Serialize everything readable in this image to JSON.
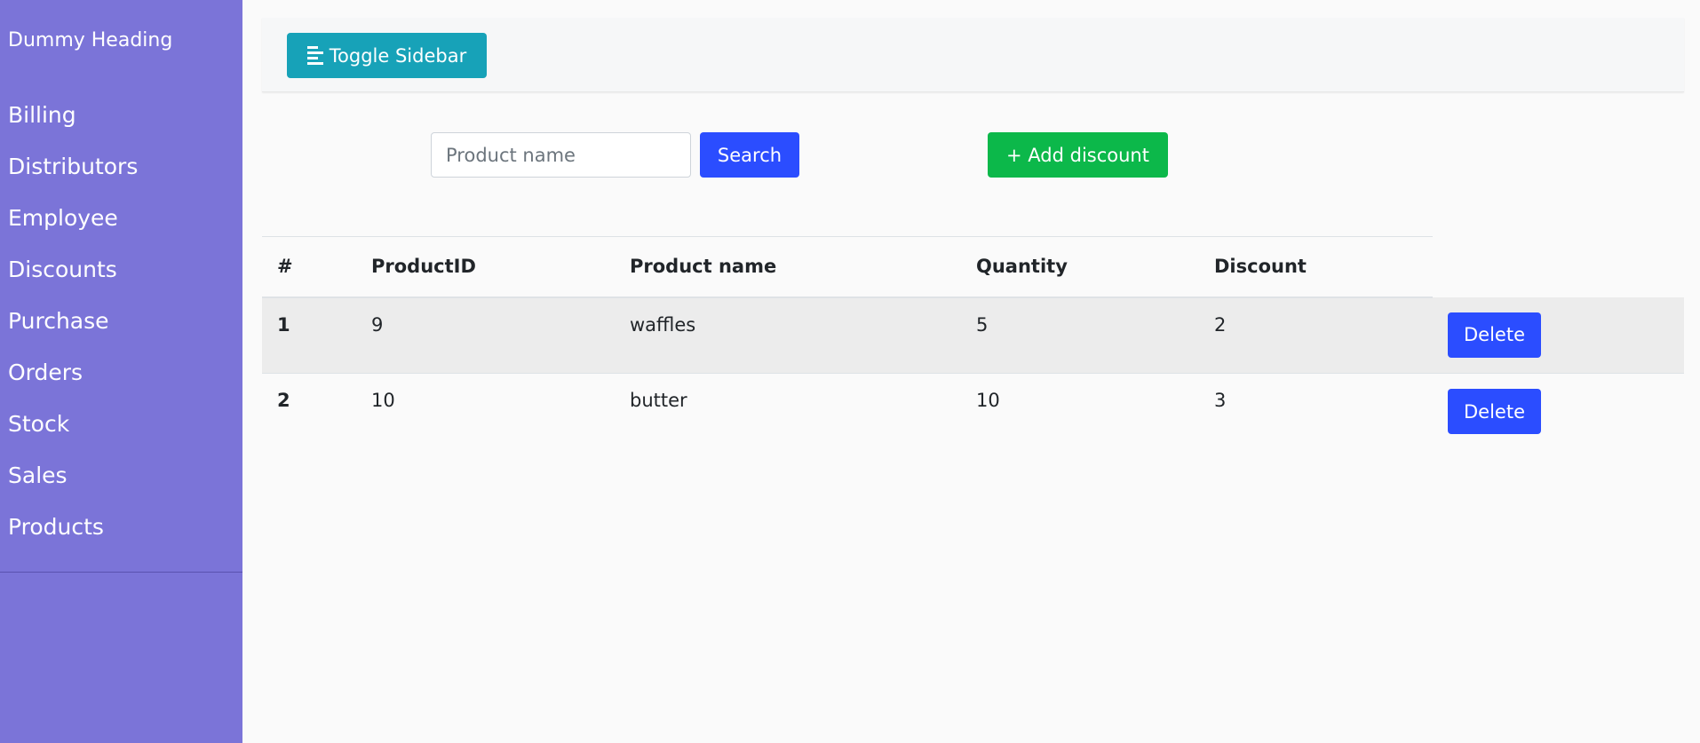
{
  "sidebar": {
    "heading": "Dummy Heading",
    "items": [
      {
        "label": "Billing"
      },
      {
        "label": "Distributors"
      },
      {
        "label": "Employee"
      },
      {
        "label": "Discounts"
      },
      {
        "label": "Purchase"
      },
      {
        "label": "Orders"
      },
      {
        "label": "Stock"
      },
      {
        "label": "Sales"
      },
      {
        "label": "Products"
      }
    ]
  },
  "topbar": {
    "toggle_label": "Toggle Sidebar",
    "toggle_icon": "align-left-icon"
  },
  "search": {
    "placeholder": "Product name",
    "value": "",
    "button_label": "Search"
  },
  "add_discount_label": "+ Add discount",
  "table": {
    "headers": [
      "#",
      "ProductID",
      "Product name",
      "Quantity",
      "Discount"
    ],
    "rows": [
      {
        "num": "1",
        "product_id": "9",
        "product_name": "waffles",
        "quantity": "5",
        "discount": "2",
        "action": "Delete"
      },
      {
        "num": "2",
        "product_id": "10",
        "product_name": "butter",
        "quantity": "10",
        "discount": "3",
        "action": "Delete"
      }
    ]
  },
  "colors": {
    "sidebar_bg": "#7b74d8",
    "toggle_bg": "#17a2b8",
    "primary": "#2b4dff",
    "success": "#0cb84a"
  }
}
